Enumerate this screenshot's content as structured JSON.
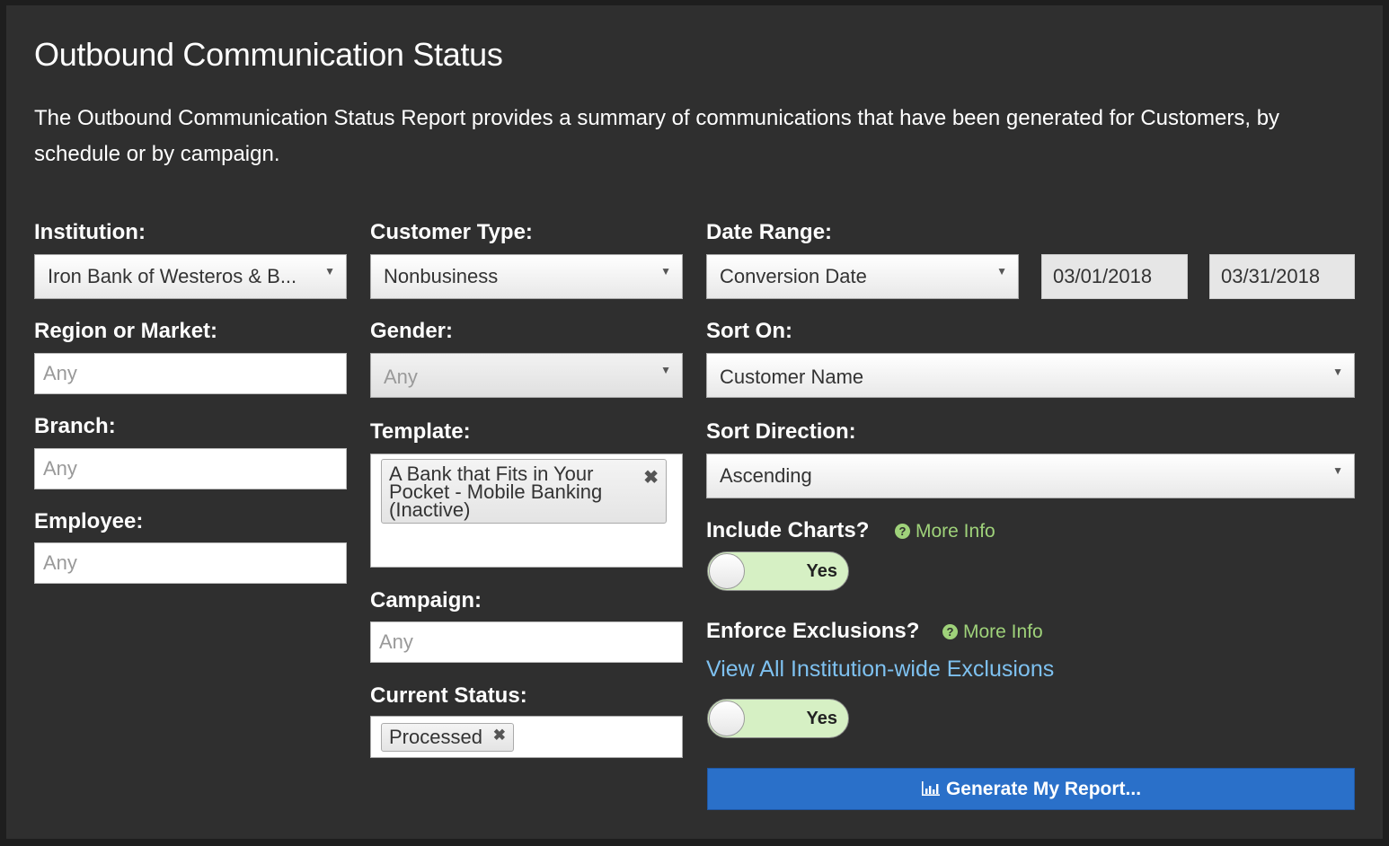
{
  "page": {
    "title": "Outbound Communication Status",
    "description": "The Outbound Communication Status Report provides a summary of communications that have been generated for Customers, by schedule or by campaign."
  },
  "colors": {
    "background": "#2f2f2f",
    "accent_green": "#9fd27a",
    "link_blue": "#7ec1f0",
    "button_blue": "#2a70c9"
  },
  "form": {
    "institution": {
      "label": "Institution:",
      "value": "Iron Bank of Westeros & B..."
    },
    "region": {
      "label": "Region or Market:",
      "placeholder": "Any"
    },
    "branch": {
      "label": "Branch:",
      "placeholder": "Any"
    },
    "employee": {
      "label": "Employee:",
      "placeholder": "Any"
    },
    "customer_type": {
      "label": "Customer Type:",
      "value": "Nonbusiness"
    },
    "gender": {
      "label": "Gender:",
      "value": "Any"
    },
    "template": {
      "label": "Template:",
      "selected": [
        "A Bank that Fits in Your Pocket - Mobile Banking (Inactive)"
      ]
    },
    "campaign": {
      "label": "Campaign:",
      "placeholder": "Any"
    },
    "current_status": {
      "label": "Current Status:",
      "selected": [
        "Processed"
      ]
    },
    "date_range": {
      "label": "Date Range:",
      "type": "Conversion Date",
      "start": "03/01/2018",
      "end": "03/31/2018"
    },
    "sort_on": {
      "label": "Sort On:",
      "value": "Customer Name"
    },
    "sort_direction": {
      "label": "Sort Direction:",
      "value": "Ascending"
    },
    "include_charts": {
      "label": "Include Charts?",
      "more_info": "More Info",
      "toggle": "Yes"
    },
    "enforce_exclusions": {
      "label": "Enforce Exclusions?",
      "more_info": "More Info",
      "link": "View All Institution-wide Exclusions",
      "toggle": "Yes"
    },
    "generate_button": "Generate My Report..."
  },
  "icons": {
    "dropdown": "caret-down-icon",
    "remove": "close-icon",
    "help": "question-circle-icon",
    "chart": "bar-chart-icon"
  }
}
